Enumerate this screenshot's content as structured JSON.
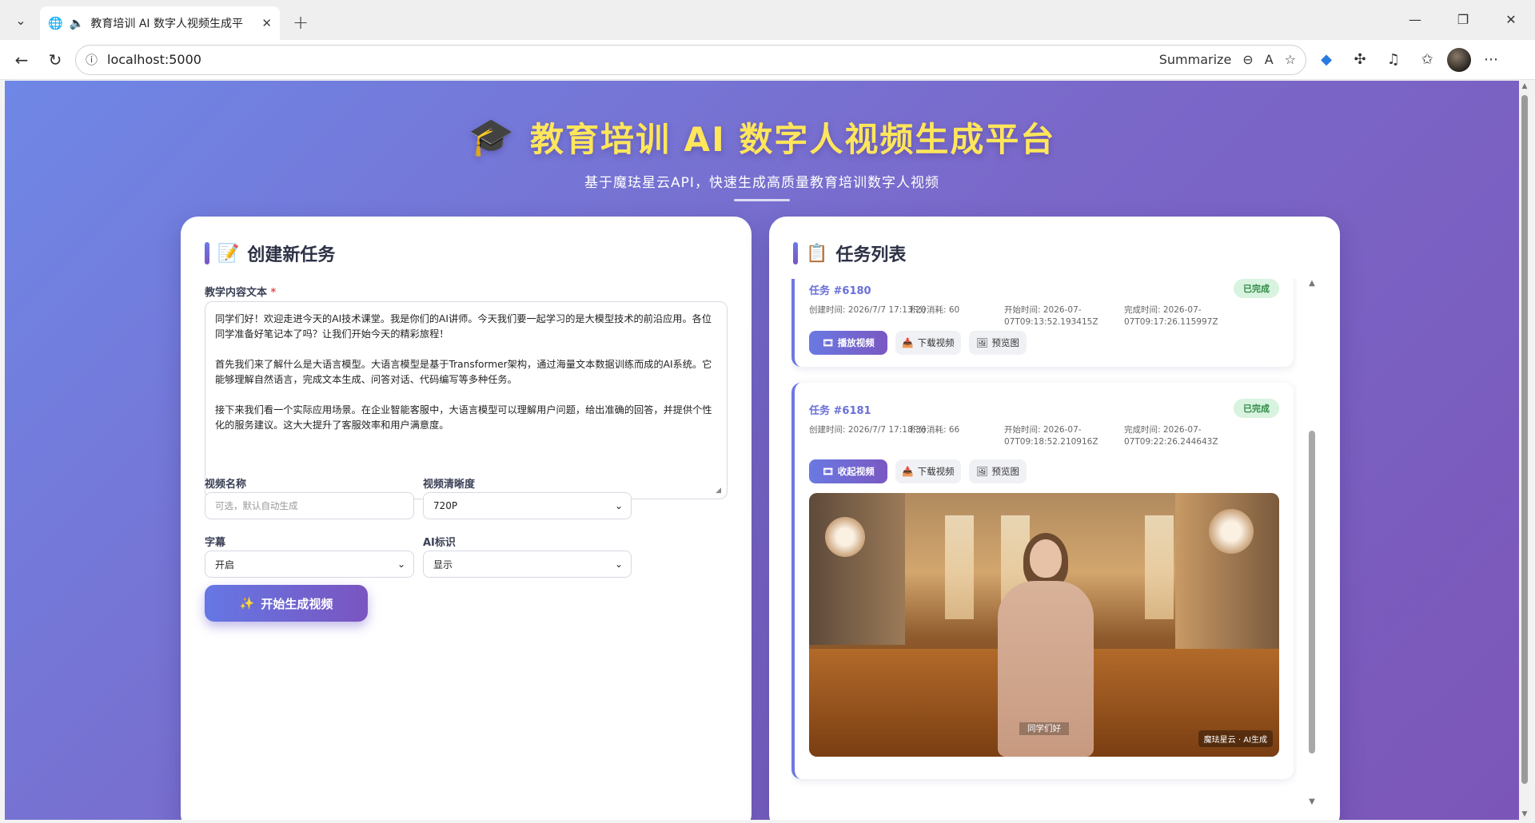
{
  "browser": {
    "tab_title": "教育培训 AI 数字人视频生成平",
    "url": "localhost:5000",
    "summarize_label": "Summarize"
  },
  "hero": {
    "title": "教育培训 AI 数字人视频生成平台",
    "subtitle": "基于魔珐星云API，快速生成高质量教育培训数字人视频"
  },
  "create": {
    "title": "创建新任务",
    "content_label": "教学内容文本",
    "content_required": "*",
    "content_text": "同学们好！欢迎走进今天的AI技术课堂。我是你们的AI讲师。今天我们要一起学习的是大模型技术的前沿应用。各位同学准备好笔记本了吗？让我们开始今天的精彩旅程！\n\n首先我们来了解什么是大语言模型。大语言模型是基于Transformer架构，通过海量文本数据训练而成的AI系统。它能够理解自然语言，完成文本生成、问答对话、代码编写等多种任务。\n\n接下来我们看一个实际应用场景。在企业智能客服中，大语言模型可以理解用户问题，给出准确的回答，并提供个性化的服务建议。这大大提升了客服效率和用户满意度。",
    "video_name_label": "视频名称",
    "video_name_placeholder": "可选，默认自动生成",
    "resolution_label": "视频清晰度",
    "resolution_value": "720P",
    "subtitle_label": "字幕",
    "subtitle_value": "开启",
    "ai_label": "AI标识",
    "ai_value": "显示",
    "submit_label": "开始生成视频"
  },
  "tasks": {
    "title": "任务列表",
    "items": [
      {
        "id": "任务 #6180",
        "status": "已完成",
        "created": "创建时间: 2026/7/7 17:13:20",
        "cost": "积分消耗: 60",
        "start": "开始时间: 2026-07-07T09:13:52.193415Z",
        "finish": "完成时间: 2026-07-07T09:17:26.115997Z",
        "play_label": "播放视频",
        "download_label": "下载视频",
        "preview_label": "预览图"
      },
      {
        "id": "任务 #6181",
        "status": "已完成",
        "created": "创建时间: 2026/7/7 17:18:36",
        "cost": "积分消耗: 66",
        "start": "开始时间: 2026-07-07T09:18:52.210916Z",
        "finish": "完成时间: 2026-07-07T09:22:26.244643Z",
        "play_label": "收起视频",
        "download_label": "下载视频",
        "preview_label": "预览图",
        "video_caption": "同学们好",
        "video_watermark": "魔珐星云 · AI生成"
      }
    ]
  },
  "colors": {
    "accent": "#6f78e0",
    "title_yellow": "#ffe65a",
    "status_green": "#2e8a44"
  }
}
